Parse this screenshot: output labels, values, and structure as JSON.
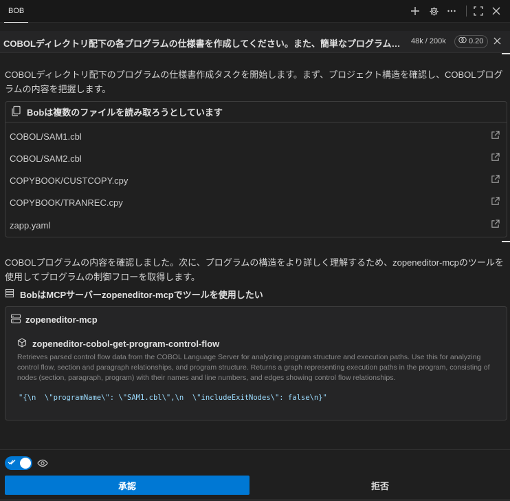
{
  "titlebar": {
    "tab_label": "BOB",
    "icons": [
      "plus-icon",
      "gear-icon",
      "ellipsis-icon",
      "maximize-icon",
      "close-icon"
    ]
  },
  "task": {
    "title": "COBOLディレクトリ配下の各プログラムの仕様書を作成してください。また、簡単なプログラム間...",
    "tokens": "48k / 200k",
    "cost": "0.20"
  },
  "messages": {
    "intro": "COBOLディレクトリ配下のプログラムの仕様書作成タスクを開始します。まず、プロジェクト構造を確認し、COBOLプログラムの内容を把握します。",
    "after_read": "COBOLプログラムの内容を確認しました。次に、プログラムの構造をより詳しく理解するため、zopeneditor-mcpのツールを使用してプログラムの制御フローを取得します。"
  },
  "files": {
    "header": "Bobは複数のファイルを読み取ろうとしています",
    "items": [
      "COBOL/SAM1.cbl",
      "COBOL/SAM2.cbl",
      "COPYBOOK/CUSTCOPY.cpy",
      "COPYBOOK/TRANREC.cpy",
      "zapp.yaml"
    ]
  },
  "mcp": {
    "title": "BobはMCPサーバーzopeneditor-mcpでツールを使用したい",
    "server": "zopeneditor-mcp",
    "tool_name": "zopeneditor-cobol-get-program-control-flow",
    "tool_description": "Retrieves parsed control flow data from the COBOL Language Server for analyzing program structure and execution paths. Use this for analyzing control flow, section and paragraph relationships, and program structure. Returns a graph representing execution paths in the program, consisting of nodes (section, paragraph, program) with their names and line numbers, and edges showing control flow relationships.",
    "tool_args": "\"{\\n  \\\"programName\\\": \\\"SAM1.cbl\\\",\\n  \\\"includeExitNodes\\\": false\\n}\""
  },
  "actions": {
    "auto_approve_enabled": true,
    "approve_label": "承認",
    "reject_label": "拒否"
  },
  "colors": {
    "accent": "#0078d4",
    "background": "#1f1f1f",
    "panel": "#252526"
  }
}
